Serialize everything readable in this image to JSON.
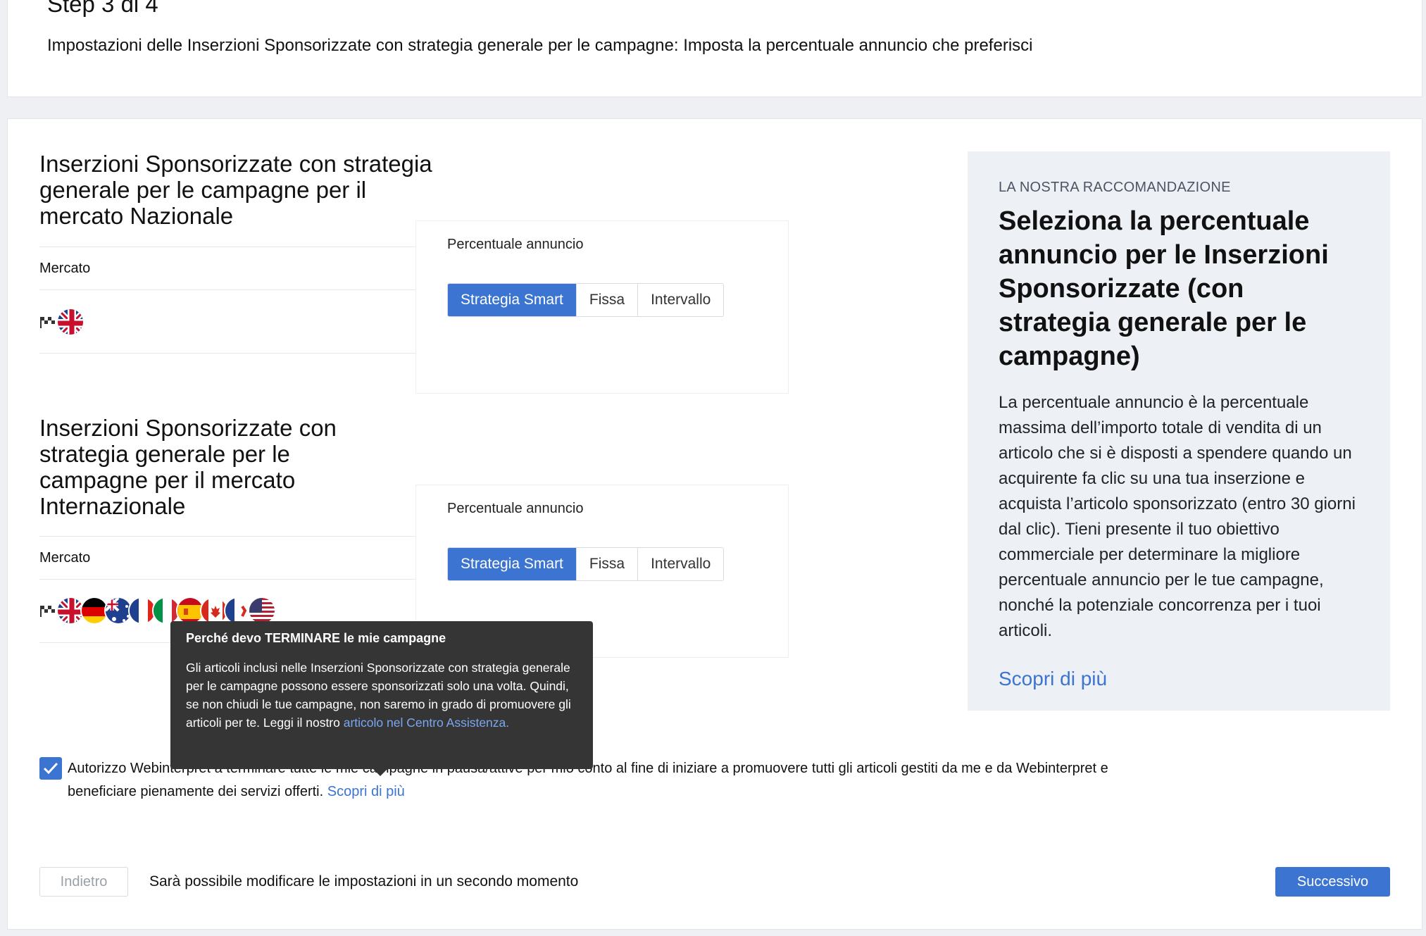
{
  "header": {
    "step": "Step 3 di 4",
    "subtitle": "Impostazioni delle Inserzioni Sponsorizzate con strategia generale per le campagne: Imposta la percentuale annuncio che preferisci"
  },
  "sections": [
    {
      "title": "Inserzioni Sponsorizzate con strategia generale per le campagne per il mercato Nazionale",
      "market_label": "Mercato",
      "flags": [
        "checkered-flag-icon",
        "uk-flag-icon"
      ],
      "percent_label": "Percentuale annuncio",
      "options": [
        "Strategia Smart",
        "Fissa",
        "Intervallo"
      ],
      "selected": "Strategia Smart"
    },
    {
      "title": "Inserzioni Sponsorizzate con strategia generale per le campagne per il mercato Internazionale",
      "market_label": "Mercato",
      "flags": [
        "checkered-flag-icon",
        "uk-flag-icon",
        "germany-flag-icon",
        "australia-flag-icon",
        "france-flag-icon",
        "italy-flag-icon",
        "spain-flag-icon",
        "canada-flag-icon",
        "france-ca-flag-icon",
        "usa-flag-icon"
      ],
      "percent_label": "Percentuale annuncio",
      "options": [
        "Strategia Smart",
        "Fissa",
        "Intervallo"
      ],
      "selected": "Strategia Smart"
    }
  ],
  "recommendation": {
    "eyebrow": "LA NOSTRA RACCOMANDAZIONE",
    "title": "Seleziona la percentuale annuncio per le Inserzioni Sponsorizzate (con strategia generale per le campagne)",
    "body": "La percentuale annuncio è la percentuale massima dell’importo totale di vendita di un articolo che si è disposti a spendere quando un acquirente fa clic su una tua inserzione e acquista l’articolo sponsorizzato (entro 30 giorni dal clic). Tieni presente il tuo obiettivo commerciale per determinare la migliore percentuale annuncio per le tue campagne, nonché la potenziale concorrenza per i tuoi articoli.",
    "link": "Scopri di più"
  },
  "tooltip": {
    "title": "Perché devo TERMINARE le mie campagne",
    "body": "Gli articoli inclusi nelle Inserzioni Sponsorizzate con strategia generale per le campagne possono essere sponsorizzati solo una volta. Quindi, se non chiudi le tue campagne, non saremo in grado di promuovere gli articoli per te. Leggi il nostro ",
    "link": "articolo nel Centro Assistenza."
  },
  "consent": {
    "checked": true,
    "text": "Autorizzo Webinterpret a terminare tutte le mie campagne in pausa/attive per mio conto al fine di iniziare a promuovere tutti gli articoli gestiti da me e da Webinterpret e beneficiare pienamente dei servizi offerti. ",
    "link": "Scopri di più"
  },
  "footer": {
    "back_label": "Indietro",
    "note": "Sarà possibile modificare le impostazioni in un secondo momento",
    "next_label": "Successivo"
  },
  "colors": {
    "accent": "#3b74d1",
    "tooltip_bg": "#353535",
    "panel_bg": "#edf0f5"
  }
}
